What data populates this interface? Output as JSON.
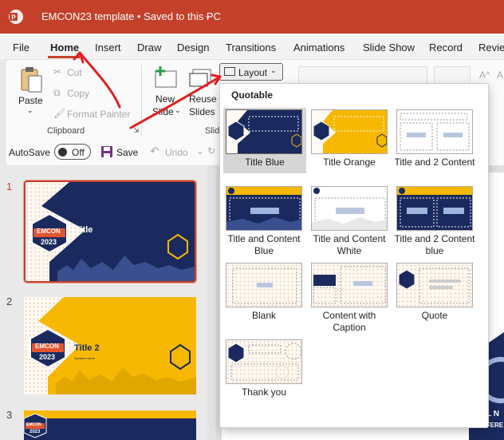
{
  "titlebar": {
    "title": "EMCON23 template  •  Saved to this PC",
    "chevron": "⌄"
  },
  "menu": [
    "File",
    "Home",
    "Insert",
    "Draw",
    "Design",
    "Transitions",
    "Animations",
    "Slide Show",
    "Record",
    "Review"
  ],
  "ribbon": {
    "paste": "Paste",
    "cut": "Cut",
    "copy": "Copy",
    "format_painter": "Format Painter",
    "clipboard_label": "Clipboard",
    "new_slide_1": "New",
    "new_slide_2": "Slide",
    "reuse_1": "Reuse",
    "reuse_2": "Slides",
    "slides_label": "Slid",
    "layout_button": "Layout"
  },
  "qat": {
    "autosave": "AutoSave",
    "toggle": "Off",
    "save": "Save",
    "undo": "Undo"
  },
  "layout_menu": {
    "heading": "Quotable",
    "layouts": [
      "Title Blue",
      "Title Orange",
      "Title and 2 Content",
      "Title and Content Blue",
      "Title and Content White",
      "Title and 2 Content blue",
      "Blank",
      "Content with Caption",
      "Quote",
      "Thank you"
    ]
  },
  "slides": [
    {
      "num": "1",
      "title": "Title",
      "badge_top": "EMCON",
      "badge_bottom": "2023"
    },
    {
      "num": "2",
      "title": "Title 2",
      "subtitle": "Speaker name",
      "badge_top": "EMCON",
      "badge_bottom": "2023"
    },
    {
      "num": "3",
      "badge_top": "EMCON",
      "badge_bottom": "2023"
    }
  ],
  "editor_fragment": {
    "text1": "L N",
    "text2": "CONFERE"
  },
  "colors": {
    "titlebar": "#c4402a",
    "navy": "#1b2a5e",
    "gold": "#f6b800",
    "annotation_red": "#e02020"
  }
}
